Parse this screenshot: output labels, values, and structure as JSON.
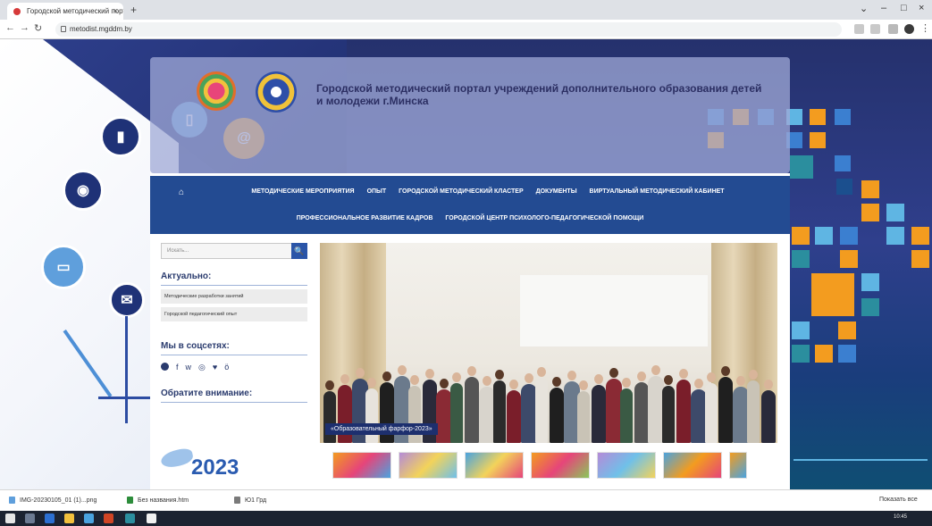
{
  "browser": {
    "tab_title": "Городской методический порт",
    "url": "metodist.mgddm.by",
    "new_tab": "+",
    "tab_close": "×"
  },
  "page": {
    "title": "Городской методический портал учреждений дополнительного образования детей и молодежи г.Минска",
    "nav_home": "⌂",
    "nav_row1": [
      "МЕТОДИЧЕСКИЕ МЕРОПРИЯТИЯ",
      "ОПЫТ",
      "ГОРОДСКОЙ МЕТОДИЧЕСКИЙ КЛАСТЕР",
      "ДОКУМЕНТЫ",
      "ВИРТУАЛЬНЫЙ МЕТОДИЧЕСКИЙ КАБИНЕТ"
    ],
    "nav_row2": [
      "ПРОФЕССИОНАЛЬНОЕ РАЗВИТИЕ КАДРОВ",
      "ГОРОДСКОЙ ЦЕНТР ПСИХОЛОГО-ПЕДАГОГИЧЕСКОЙ ПОМОЩИ"
    ],
    "search_placeholder": "Искать...",
    "search_button": "🔍",
    "sidebar": {
      "actual_heading": "Актуально:",
      "links": [
        "Методические разработки занятий",
        "Городской педагогический опыт"
      ],
      "social_heading": "Мы в соцсетях:",
      "social_icons": [
        "vk-icon",
        "facebook-icon",
        "vk-alt-icon",
        "instagram-icon",
        "twitter-icon",
        "ok-icon"
      ],
      "social_glyphs": [
        "f",
        "w",
        "◎",
        "♥",
        "ӧ"
      ],
      "attention_heading": "Обратите внимание:",
      "year_logo": "2023"
    },
    "slider_caption": "«Образовательный фарфор-2023»"
  },
  "downloads": [
    "IMG-20230105_01 (1)...png",
    "Без названия.htm",
    "Ю1 Грд"
  ],
  "downloads_show_all": "Показать все",
  "taskbar": {
    "tray_time": "10:45"
  },
  "colors": {
    "nav_bg": "#234b92",
    "accent_orange": "#f39c1f",
    "heading": "#2a3b6e",
    "caption_bg": "#1d2f6e"
  }
}
